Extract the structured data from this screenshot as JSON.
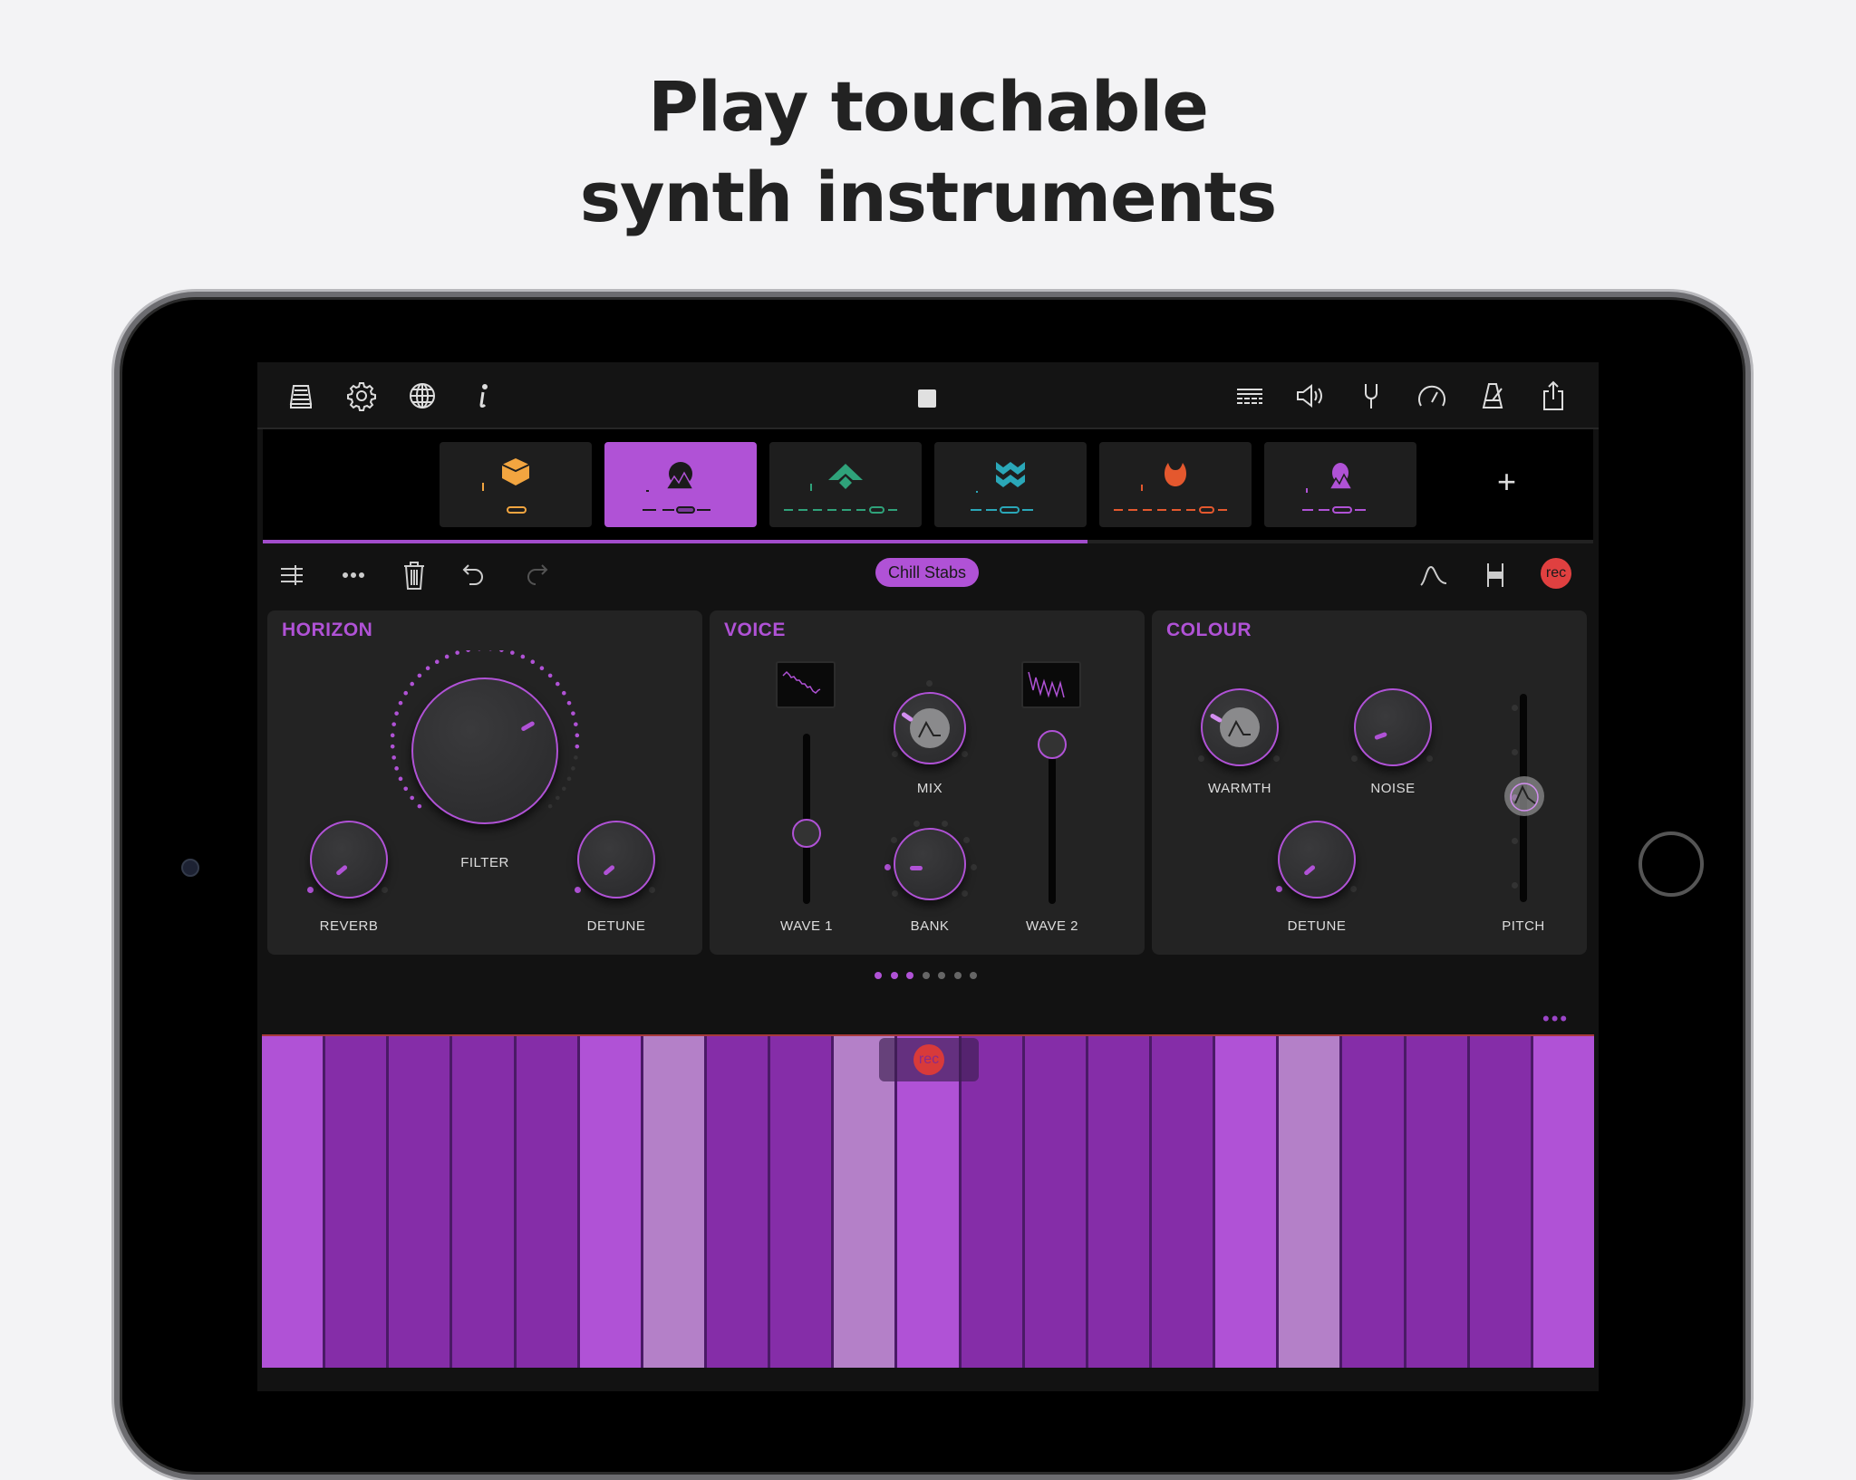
{
  "headline": {
    "line1": "Play touchable",
    "line2": "synth instruments"
  },
  "topbar": {
    "left_icons": [
      "library-icon",
      "settings-gear-icon",
      "globe-icon",
      "info-icon"
    ],
    "center": "stop-icon",
    "right_icons": [
      "mixer-lines-icon",
      "volume-speaker-icon",
      "tuning-fork-icon",
      "tempo-gauge-icon",
      "metronome-icon",
      "share-icon"
    ]
  },
  "tracks": {
    "items": [
      {
        "icon": "cube-icon",
        "color": "#f2a540",
        "active": false
      },
      {
        "icon": "moon-mountain-icon",
        "color": "#1a1a1a",
        "active": true
      },
      {
        "icon": "chevron-diamond-icon",
        "color": "#2fa27a",
        "active": false
      },
      {
        "icon": "waves-icon",
        "color": "#2aa7b8",
        "active": false
      },
      {
        "icon": "flame-drop-icon",
        "color": "#e4582e",
        "active": false
      },
      {
        "icon": "moon-mountain-icon",
        "color": "#b052d6",
        "active": false
      }
    ],
    "add_label": "+",
    "progress": 0.62
  },
  "toolbar": {
    "left_icons": [
      "track-settings-icon",
      "more-icon",
      "trash-icon",
      "undo-icon",
      "redo-icon"
    ],
    "preset_name": "Chill Stabs",
    "right_icons": [
      "envelope-icon",
      "arpeggiator-icon"
    ],
    "rec_label": "rec"
  },
  "panels": {
    "horizon": {
      "title": "HORIZON",
      "filter_label": "FILTER",
      "reverb_label": "REVERB",
      "detune_label": "DETUNE",
      "filter_value": 0.85,
      "reverb_value": 0.2,
      "detune_value": 0.2
    },
    "voice": {
      "title": "VOICE",
      "wave1_label": "WAVE 1",
      "mix_label": "MIX",
      "bank_label": "BANK",
      "wave2_label": "WAVE 2",
      "wave1_value": 0.4,
      "wave2_value": 0.9,
      "bank_value": 0.0
    },
    "colour": {
      "title": "COLOUR",
      "warmth_label": "WARMTH",
      "noise_label": "NOISE",
      "detune_label": "DETUNE",
      "pitch_label": "PITCH",
      "noise_value": 0.3,
      "detune_value": 0.2,
      "pitch_value": 0.5
    }
  },
  "pager": {
    "total": 7,
    "active": 3
  },
  "keyboard": {
    "more_label": "•••",
    "rec_label": "rec",
    "keys": [
      "bright",
      "dark",
      "dark",
      "dark",
      "dark",
      "bright",
      "light",
      "dark",
      "dark",
      "light",
      "bright",
      "dark",
      "dark",
      "dark",
      "dark",
      "bright",
      "light",
      "dark",
      "dark",
      "dark",
      "bright"
    ],
    "colors": {
      "bright": "#b052d6",
      "dark": "#852da8",
      "light": "#b480c8"
    }
  }
}
